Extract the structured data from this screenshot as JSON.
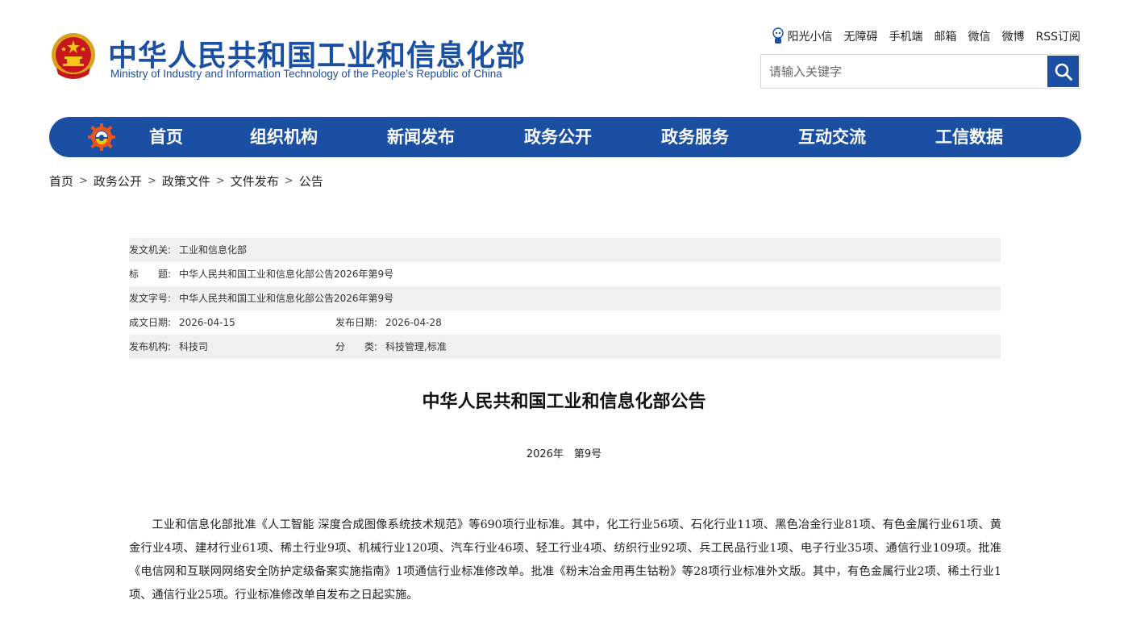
{
  "header": {
    "title_cn": "中华人民共和国工业和信息化部",
    "title_en": "Ministry of Industry and Information Technology of the People’s Republic of China",
    "toplinks": {
      "sunshine": "阳光小信",
      "accessibility": "无障碍",
      "mobile": "手机端",
      "mailbox": "邮箱",
      "wechat": "微信",
      "weibo": "微博",
      "rss": "RSS订阅"
    },
    "search": {
      "placeholder": "请输入关键字",
      "icon": "search-icon"
    },
    "brand_color": "#1a4fa3"
  },
  "nav": {
    "items": [
      "首页",
      "组织机构",
      "新闻发布",
      "政务公开",
      "政务服务",
      "互动交流",
      "工信数据"
    ]
  },
  "breadcrumb": [
    "首页",
    "政务公开",
    "政策文件",
    "文件发布",
    "公告"
  ],
  "breadcrumb_separator": ">",
  "meta": {
    "issuer_label": "发文机关:",
    "issuer": "工业和信息化部",
    "title_label": "标　　题:",
    "title": "中华人民共和国工业和信息化部公告2026年第9号",
    "docno_label": "发文字号:",
    "docno": "中华人民共和国工业和信息化部公告2026年第9号",
    "created_label": "成文日期:",
    "created": "2026-04-15",
    "published_label": "发布日期:",
    "published": "2026-04-28",
    "agency_label": "发布机构:",
    "agency": "科技司",
    "category_label": "分　　类:",
    "category": "科技管理,标准"
  },
  "article": {
    "title": "中华人民共和国工业和信息化部公告",
    "number": "2026年　第9号",
    "body": "工业和信息化部批准《人工智能 深度合成图像系统技术规范》等690项行业标准。其中，化工行业56项、石化行业11项、黑色冶金行业81项、有色金属行业61项、黄金行业4项、建材行业61项、稀土行业9项、机械行业120项、汽车行业46项、轻工行业4项、纺织行业92项、兵工民品行业1项、电子行业35项、通信行业109项。批准《电信网和互联网网络安全防护定级备案实施指南》1项通信行业标准修改单。批准《粉末冶金用再生钴粉》等28项行业标准外文版。其中，有色金属行业2项、稀土行业1项、通信行业25项。行业标准修改单自发布之日起实施。"
  }
}
